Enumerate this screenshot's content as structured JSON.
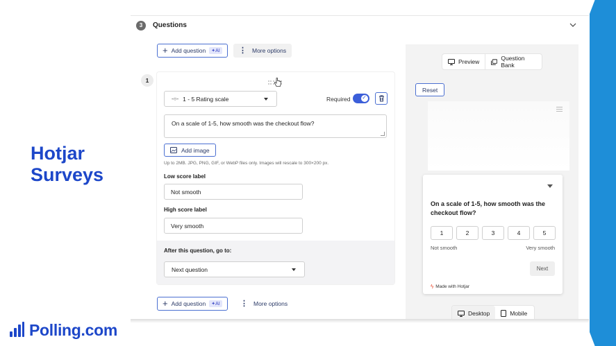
{
  "brand": {
    "title_line1": "Hotjar",
    "title_line2": "Surveys",
    "logo_text": "Polling.com",
    "accent_color": "#1d47c9",
    "band_color": "#1e8ed8"
  },
  "section": {
    "step_number": "3",
    "title": "Questions"
  },
  "toolbar": {
    "add_question_label": "Add question",
    "ai_badge": "AI",
    "more_options_label": "More options"
  },
  "question": {
    "number": "1",
    "type_label": "1 - 5 Rating scale",
    "required_label": "Required",
    "required_on": true,
    "text": "On a scale of 1-5, how smooth was the checkout flow?",
    "add_image_label": "Add image",
    "image_hint": "Up to 2MB. JPG, PNG, GIF, or WebP files only. Images will rescale to 300×200 px.",
    "low_score_label_title": "Low score label",
    "low_score_value": "Not smooth",
    "high_score_label_title": "High score label",
    "high_score_value": "Very smooth",
    "after_label": "After this question, go to:",
    "after_value": "Next question"
  },
  "preview": {
    "tab_preview": "Preview",
    "tab_question_bank": "Question Bank",
    "reset_label": "Reset",
    "widget_question": "On a scale of 1-5, how smooth was the checkout flow?",
    "scale": [
      "1",
      "2",
      "3",
      "4",
      "5"
    ],
    "low_label": "Not smooth",
    "high_label": "Very smooth",
    "next_label": "Next",
    "made_with": "Made with Hotjar",
    "device_desktop": "Desktop",
    "device_mobile": "Mobile"
  }
}
